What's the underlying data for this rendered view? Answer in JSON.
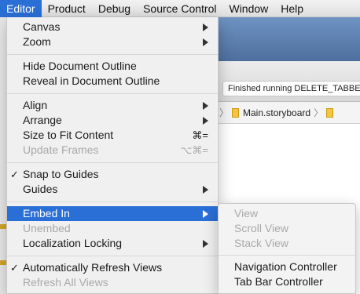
{
  "menubar": {
    "items": [
      "Editor",
      "Product",
      "Debug",
      "Source Control",
      "Window",
      "Help"
    ],
    "active": "Editor"
  },
  "background": {
    "status_text": "Finished running DELETE_TABBE",
    "breadcrumb_file": "Main.storyboard"
  },
  "editor_menu": {
    "canvas": "Canvas",
    "zoom": "Zoom",
    "hide_outline": "Hide Document Outline",
    "reveal_outline": "Reveal in Document Outline",
    "align": "Align",
    "arrange": "Arrange",
    "size_to_fit": "Size to Fit Content",
    "size_to_fit_shortcut": "⌘=",
    "update_frames": "Update Frames",
    "update_frames_shortcut": "⌥⌘=",
    "snap_to_guides": "Snap to Guides",
    "guides": "Guides",
    "embed_in": "Embed In",
    "unembed": "Unembed",
    "localization_locking": "Localization Locking",
    "auto_refresh": "Automatically Refresh Views",
    "refresh_all": "Refresh All Views",
    "checkmark": "✓"
  },
  "embed_submenu": {
    "view": "View",
    "scroll_view": "Scroll View",
    "stack_view": "Stack View",
    "navigation_controller": "Navigation Controller",
    "tab_bar_controller": "Tab Bar Controller"
  },
  "colors": {
    "highlight": "#2a6fd6",
    "disabled_text": "#a9a9a9"
  }
}
